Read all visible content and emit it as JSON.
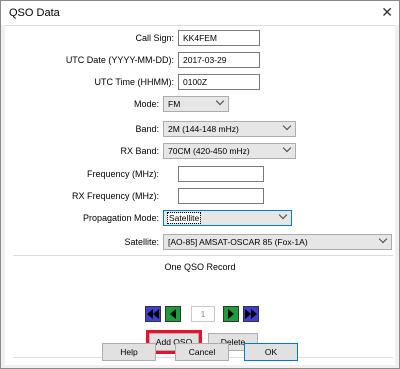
{
  "window": {
    "title": "QSO Data"
  },
  "fields": {
    "call_sign": {
      "label": "Call Sign:",
      "value": "KK4FEM"
    },
    "utc_date": {
      "label": "UTC Date (YYYY-MM-DD):",
      "value": "2017-03-29"
    },
    "utc_time": {
      "label": "UTC Time (HHMM):",
      "value": "0100Z"
    },
    "mode": {
      "label": "Mode:",
      "value": "FM"
    },
    "band": {
      "label": "Band:",
      "value": "2M (144-148 mHz)"
    },
    "rx_band": {
      "label": "RX Band:",
      "value": "70CM (420-450 mHz)"
    },
    "frequency": {
      "label": "Frequency (MHz):",
      "value": ""
    },
    "rx_frequency": {
      "label": "RX Frequency (MHz):",
      "value": ""
    },
    "propagation_mode": {
      "label": "Propagation Mode:",
      "value": "Satellite"
    },
    "satellite": {
      "label": "Satellite:",
      "value": "[AO-85] AMSAT-OSCAR 85 (Fox-1A)"
    }
  },
  "record": {
    "label": "One QSO Record",
    "number": "1"
  },
  "actions": {
    "add_qso": "Add QSO",
    "delete": "Delete"
  },
  "footer": {
    "help": "Help",
    "cancel": "Cancel",
    "ok": "OK"
  },
  "icons": {
    "close": "close-icon",
    "first": "first-record-icon",
    "prev": "previous-record-icon",
    "next": "next-record-icon",
    "last": "last-record-icon"
  },
  "colors": {
    "highlight": "#e8102e",
    "nav_blue": "#3f3fd6",
    "nav_green": "#1e9e3a",
    "focus": "#0078d7"
  }
}
